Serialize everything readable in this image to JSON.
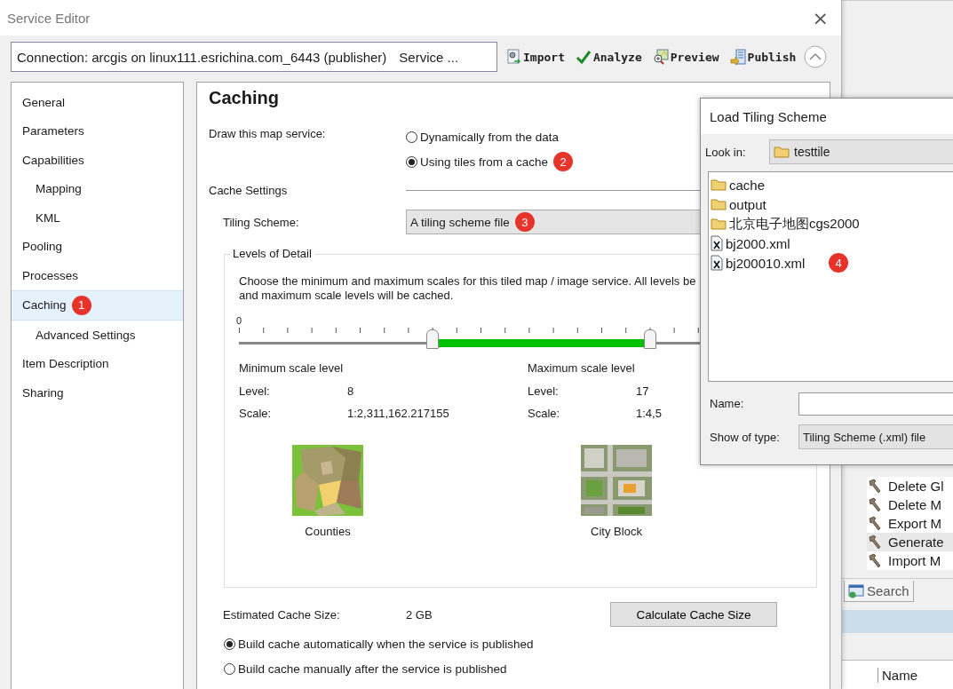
{
  "window": {
    "title": "Service Editor",
    "close": "×"
  },
  "connection": {
    "text": "Connection: arcgis on linux111.esrichina.com_6443 (publisher)",
    "service": "Service ..."
  },
  "toolbar": [
    {
      "label": "Import",
      "kind": "import"
    },
    {
      "label": "Analyze",
      "kind": "analyze"
    },
    {
      "label": "Preview",
      "kind": "preview"
    },
    {
      "label": "Publish",
      "kind": "publish"
    }
  ],
  "sidebar": {
    "items": [
      {
        "label": "General",
        "selected": false
      },
      {
        "label": "Parameters",
        "selected": false
      },
      {
        "label": "Capabilities",
        "selected": false,
        "children": [
          {
            "label": "Mapping",
            "selected": false
          },
          {
            "label": "KML",
            "selected": false
          }
        ]
      },
      {
        "label": "Pooling",
        "selected": false
      },
      {
        "label": "Processes",
        "selected": false
      },
      {
        "label": "Caching",
        "selected": true,
        "badge": "1",
        "children": [
          {
            "label": "Advanced Settings",
            "selected": false
          }
        ]
      },
      {
        "label": "Item Description",
        "selected": false
      },
      {
        "label": "Sharing",
        "selected": false
      }
    ]
  },
  "caching": {
    "heading": "Caching",
    "draw_label": "Draw this map service:",
    "draw_options": [
      {
        "label": "Dynamically from the data",
        "selected": false
      },
      {
        "label": "Using tiles from a cache",
        "selected": true,
        "badge": "2"
      }
    ],
    "cache_settings": "Cache Settings",
    "tiling_label": "Tiling Scheme:",
    "tiling_value": "A tiling scheme file",
    "tiling_badge": "3",
    "lod": {
      "legend": "Levels of Detail",
      "description": "Choose the minimum and maximum scales for this tiled map / image service. All levels be\nand maximum scale levels will be cached.",
      "slider": {
        "start_label": "0",
        "thumbs": [
          {
            "level": 0.348
          },
          {
            "level": 0.739
          }
        ]
      },
      "min": {
        "title": "Minimum scale level",
        "level_label": "Level:",
        "level": "8",
        "scale_label": "Scale:",
        "scale": "1:2,311,162.217155",
        "caption": "Counties",
        "kind": "counties"
      },
      "max": {
        "title": "Maximum scale level",
        "level_label": "Level:",
        "level": "17",
        "scale_label": "Scale:",
        "scale": "1:4,5",
        "caption": "City Block",
        "kind": "city"
      }
    },
    "estimated_label": "Estimated Cache Size:",
    "estimated_value": "2 GB",
    "calculate_button": "Calculate Cache Size",
    "build_options": [
      {
        "label": "Build cache automatically when the service is published",
        "selected": true
      },
      {
        "label": "Build cache manually after the service is published",
        "selected": false
      }
    ]
  },
  "dialog": {
    "title": "Load Tiling Scheme",
    "look_in_label": "Look in:",
    "look_in": "testtile",
    "files": [
      {
        "name": "cache",
        "kind": "folder"
      },
      {
        "name": "output",
        "kind": "folder"
      },
      {
        "name": "北京电子地图cgs2000",
        "kind": "folder"
      },
      {
        "name": "bj2000.xml",
        "kind": "xml"
      },
      {
        "name": "bj200010.xml",
        "kind": "xml",
        "badge": "4"
      }
    ],
    "name_label": "Name:",
    "type_label": "Show of type:",
    "type_value": "Tiling Scheme (.xml) file"
  },
  "toolbox": {
    "items": [
      {
        "label": "Delete Gl",
        "selected": false
      },
      {
        "label": "Delete M",
        "selected": false
      },
      {
        "label": "Export M",
        "selected": false
      },
      {
        "label": "Generate",
        "selected": true
      },
      {
        "label": "Import M",
        "selected": false
      }
    ],
    "tab": "Search",
    "column": "Name"
  }
}
